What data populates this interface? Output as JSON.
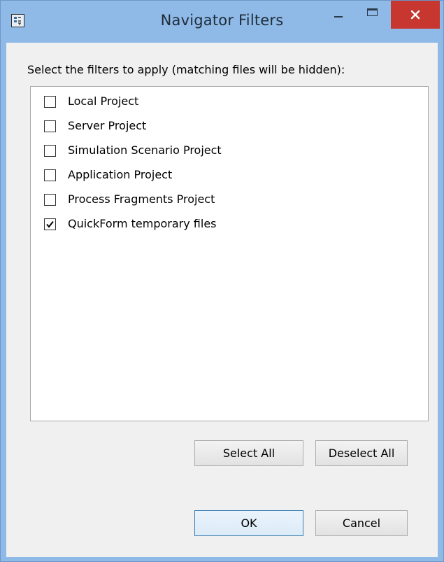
{
  "window": {
    "title": "Navigator Filters",
    "icon": "filter-settings-icon"
  },
  "title_controls": {
    "minimize": "minimize-icon",
    "maximize": "maximize-icon",
    "close": "close-icon"
  },
  "dialog": {
    "instruction": "Select the filters to apply (matching files will be hidden):",
    "filters": [
      {
        "label": "Local Project",
        "checked": false
      },
      {
        "label": "Server Project",
        "checked": false
      },
      {
        "label": "Simulation Scenario Project",
        "checked": false
      },
      {
        "label": "Application Project",
        "checked": false
      },
      {
        "label": "Process Fragments Project",
        "checked": false
      },
      {
        "label": "QuickForm temporary files",
        "checked": true
      }
    ],
    "select_all_label": "Select All",
    "deselect_all_label": "Deselect All",
    "ok_label": "OK",
    "cancel_label": "Cancel"
  },
  "colors": {
    "frame": "#8fb9e6",
    "close_button": "#c7372f",
    "client_bg": "#f0f0f0"
  }
}
